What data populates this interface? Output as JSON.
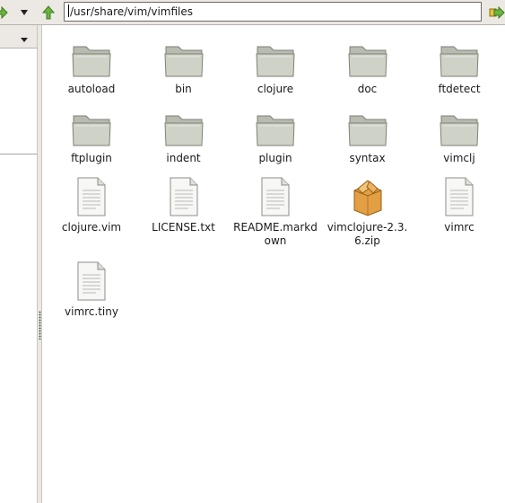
{
  "location": {
    "path": "/usr/share/vim/vimfiles"
  },
  "icons": {
    "forward": "green-right-arrow-icon",
    "up": "green-up-arrow-icon",
    "go": "go-arrow-icon",
    "folder": "folder-icon",
    "text_file": "text-file-icon",
    "archive": "package-archive-icon"
  },
  "colors": {
    "green": "#5ea33a",
    "folder": "#c9ccc2",
    "archive": "#e3a24a"
  },
  "files": [
    {
      "name": "autoload",
      "type": "folder"
    },
    {
      "name": "bin",
      "type": "folder"
    },
    {
      "name": "clojure",
      "type": "folder"
    },
    {
      "name": "doc",
      "type": "folder"
    },
    {
      "name": "ftdetect",
      "type": "folder"
    },
    {
      "name": "ftplugin",
      "type": "folder"
    },
    {
      "name": "indent",
      "type": "folder"
    },
    {
      "name": "plugin",
      "type": "folder"
    },
    {
      "name": "syntax",
      "type": "folder"
    },
    {
      "name": "vimclj",
      "type": "folder"
    },
    {
      "name": "clojure.vim",
      "type": "text"
    },
    {
      "name": "LICENSE.txt",
      "type": "text"
    },
    {
      "name": "README.markdown",
      "type": "text"
    },
    {
      "name": "vimclojure-2.3.6.zip",
      "type": "archive"
    },
    {
      "name": "vimrc",
      "type": "text"
    },
    {
      "name": "vimrc.tiny",
      "type": "text"
    }
  ]
}
